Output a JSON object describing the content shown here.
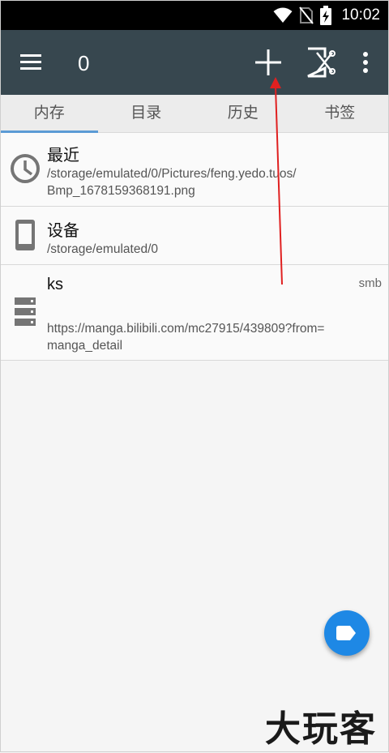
{
  "status_bar": {
    "time": "10:02",
    "icons": [
      "wifi-icon",
      "no-sim-icon",
      "battery-charging-icon"
    ]
  },
  "app_bar": {
    "title": "0",
    "menu_icon": "menu-icon",
    "add_icon": "add-icon",
    "cut_icon": "cut-icon",
    "more_icon": "more-vert-icon",
    "background": "#37474f"
  },
  "tabs": [
    {
      "label": "内存",
      "active": true
    },
    {
      "label": "目录",
      "active": false
    },
    {
      "label": "历史",
      "active": false
    },
    {
      "label": "书签",
      "active": false
    }
  ],
  "items": [
    {
      "name": "最近",
      "path": "/storage/emulated/0/Pictures/feng.yedo.tuos/",
      "path2": "Bmp_1678159368191.png",
      "icon": "clock-icon"
    },
    {
      "name": "设备",
      "path": "/storage/emulated/0",
      "icon": "phone-icon"
    },
    {
      "name": "ks",
      "protocol": "smb",
      "path": "https://manga.bilibili.com/mc27915/439809?from=",
      "path2": "manga_detail",
      "icon": "server-icon"
    }
  ],
  "fab": {
    "icon": "tag-icon",
    "color": "#1e88e5"
  },
  "watermark": {
    "text": "大玩客"
  },
  "annotation": {
    "color": "#e02020"
  }
}
